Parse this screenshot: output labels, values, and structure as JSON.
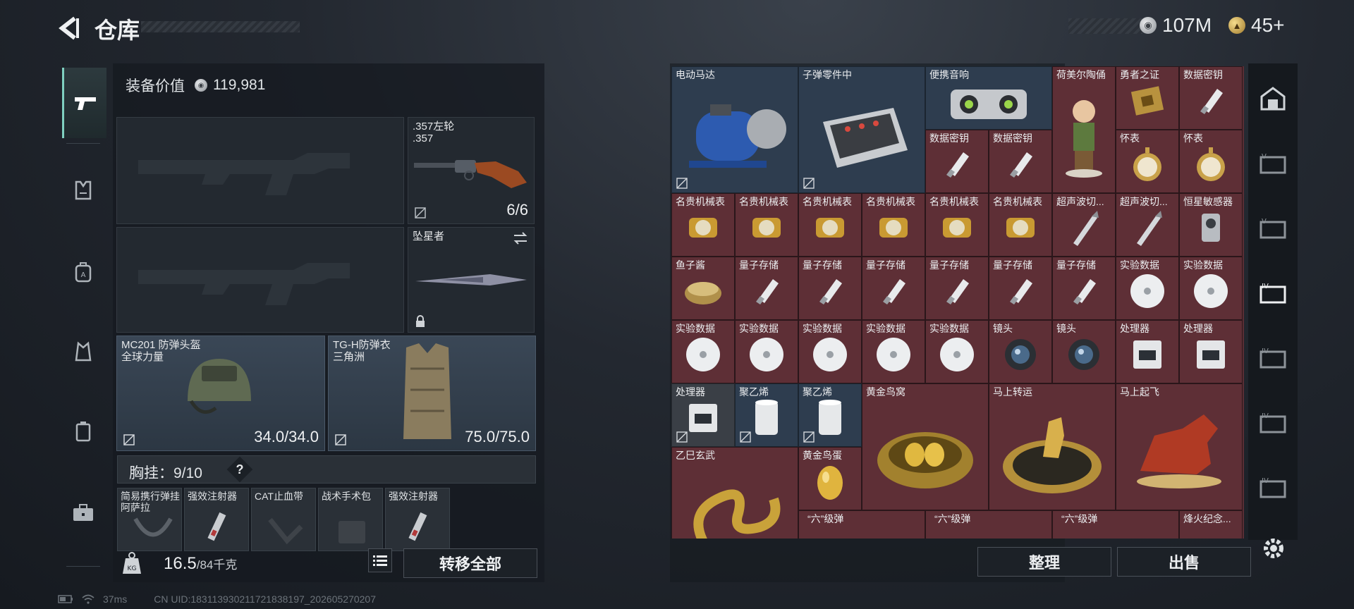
{
  "header": {
    "title": "仓库",
    "currency_silver": "107M",
    "currency_gold": "45+"
  },
  "left": {
    "equip_value_label": "装备价值",
    "equip_value": "119,981",
    "sidearm": {
      "name": ".357左轮",
      "sub": ".357",
      "count": "6/6"
    },
    "melee": {
      "name": "坠星者"
    },
    "helmet": {
      "name": "MC201 防弹头盔",
      "sub": "全球力量",
      "durability": "34.0/34.0"
    },
    "vest": {
      "name": "TG-H防弹衣",
      "sub": "三角洲",
      "durability": "75.0/75.0"
    },
    "rig": {
      "label": "胸挂：",
      "count": "9/10",
      "help": "?"
    },
    "rig_items": [
      {
        "name": "简易携行弹挂",
        "sub": "阿萨拉"
      },
      {
        "name": "强效注射器",
        "sub": ""
      },
      {
        "name": "CAT止血带",
        "sub": ""
      },
      {
        "name": "战术手术包",
        "sub": ""
      },
      {
        "name": "强效注射器",
        "sub": ""
      }
    ],
    "weight": "16.5",
    "weight_max": "/84千克",
    "transfer_all": "转移全部"
  },
  "status": {
    "ping": "37ms",
    "uid": "CN UID:18311393021172183819​7_202605270207"
  },
  "grid_items": [
    {
      "name": "电动马达",
      "icon": "motor-icon",
      "color": "blue"
    },
    {
      "name": "子弹零件中",
      "icon": "toolbox-icon",
      "color": "blue"
    },
    {
      "name": "便携音响",
      "icon": "speaker-icon",
      "color": "blue"
    },
    {
      "name": "荷美尔陶俑",
      "icon": "figurine-icon",
      "color": "red"
    },
    {
      "name": "勇者之证",
      "icon": "badge-icon",
      "color": "red"
    },
    {
      "name": "数据密钥",
      "icon": "usb-key-icon",
      "color": "red"
    },
    {
      "name": "数据密钥",
      "icon": "usb-key-icon",
      "color": "red"
    },
    {
      "name": "数据密钥",
      "icon": "usb-key-icon",
      "color": "red"
    },
    {
      "name": "怀表",
      "icon": "pocket-watch-icon",
      "color": "red"
    },
    {
      "name": "怀表",
      "icon": "pocket-watch-icon",
      "color": "red"
    },
    {
      "name": "名贵机械表",
      "icon": "wristwatch-icon",
      "color": "red"
    },
    {
      "name": "超声波切...",
      "icon": "ultrasonic-cutter-icon",
      "color": "red"
    },
    {
      "name": "超声波切...",
      "icon": "ultrasonic-cutter-icon",
      "color": "red"
    },
    {
      "name": "恒星敏感器",
      "icon": "sensor-icon",
      "color": "red"
    },
    {
      "name": "鱼子酱",
      "icon": "caviar-icon",
      "color": "red"
    },
    {
      "name": "量子存储",
      "icon": "usb-key-icon",
      "color": "red"
    },
    {
      "name": "实验数据",
      "icon": "disc-icon",
      "color": "red"
    },
    {
      "name": "镜头",
      "icon": "lens-icon",
      "color": "red"
    },
    {
      "name": "处理器",
      "icon": "processor-icon",
      "color": "red"
    },
    {
      "name": "聚乙烯",
      "icon": "roll-icon",
      "color": "blue"
    },
    {
      "name": "黄金鸟窝",
      "icon": "golden-nest-icon",
      "color": "red"
    },
    {
      "name": "马上转运",
      "icon": "fortune-disc-icon",
      "color": "red"
    },
    {
      "name": "马上起飞",
      "icon": "horse-statue-icon",
      "color": "red"
    },
    {
      "name": "乙巳玄武",
      "icon": "dragon-statue-icon",
      "color": "red"
    },
    {
      "name": "黄金鸟蛋",
      "icon": "golden-egg-icon",
      "color": "red"
    },
    {
      "name": "“六”级弹",
      "icon": "bullet-icon",
      "color": "red"
    },
    {
      "name": "烽火纪念...",
      "icon": "memorial-icon",
      "color": "red"
    }
  ],
  "actions": {
    "sort": "整理",
    "sell": "出售"
  }
}
